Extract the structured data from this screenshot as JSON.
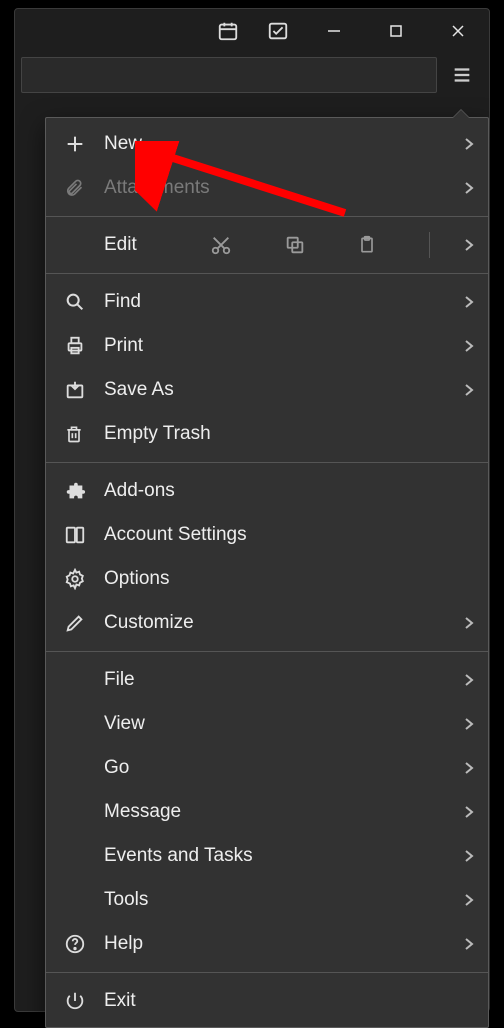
{
  "menu": {
    "new": "New",
    "attachments": "Attachments",
    "edit": "Edit",
    "find": "Find",
    "print": "Print",
    "saveAs": "Save As",
    "emptyTrash": "Empty Trash",
    "addons": "Add-ons",
    "accountSettings": "Account Settings",
    "options": "Options",
    "customize": "Customize",
    "file": "File",
    "view": "View",
    "go": "Go",
    "message": "Message",
    "eventsTasks": "Events and Tasks",
    "tools": "Tools",
    "help": "Help",
    "exit": "Exit"
  }
}
